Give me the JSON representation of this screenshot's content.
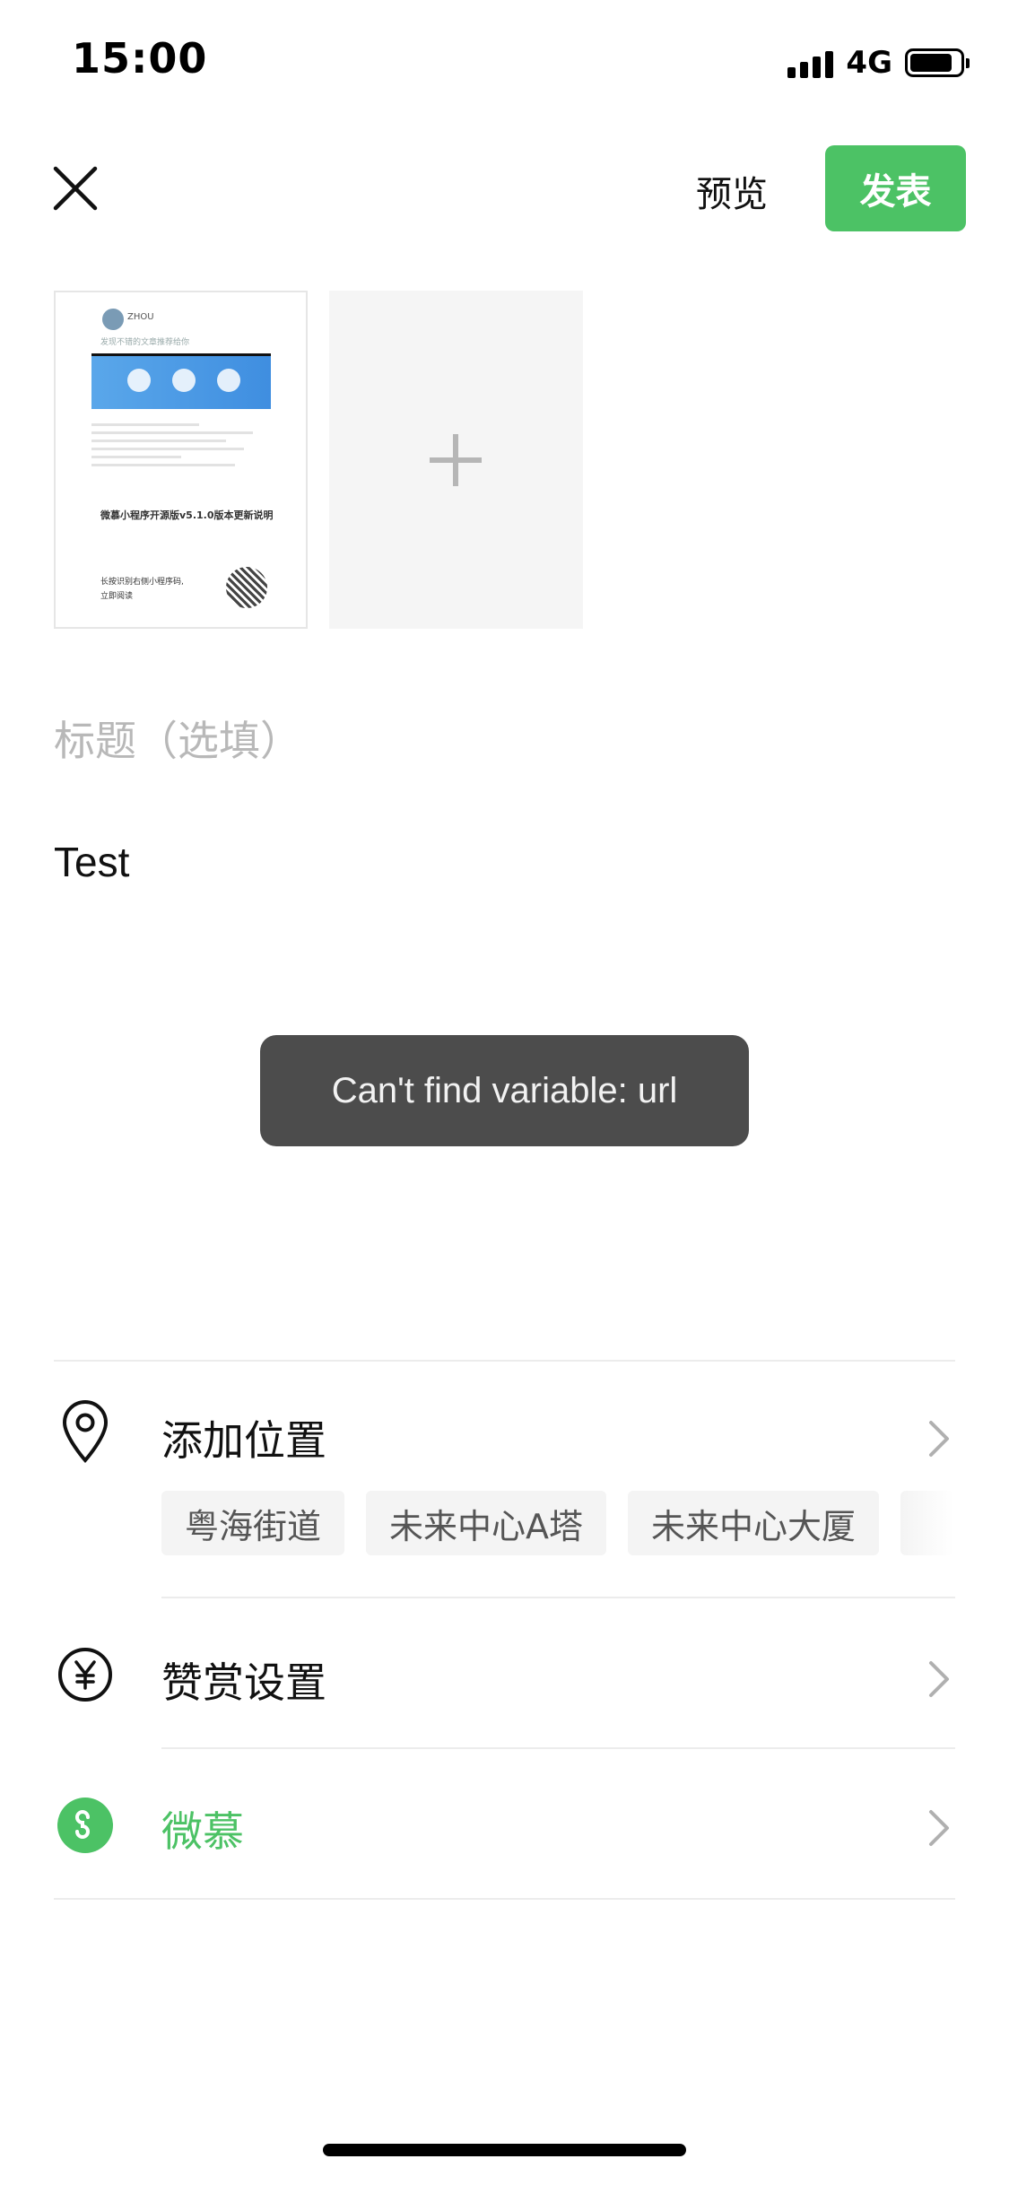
{
  "status_bar": {
    "time": "15:00",
    "network": "4G",
    "signal_icon": "signal-bars-icon",
    "battery_icon": "battery-icon"
  },
  "header": {
    "close_icon": "close-icon",
    "preview_label": "预览",
    "publish_label": "发表",
    "publish_color": "#4cc265"
  },
  "images": {
    "thumbnail": {
      "author": "ZHOU",
      "subtitle": "发现不错的文章推荐给你",
      "caption": "微慕小程序开源版v5.1.0版本更新说明",
      "footer_line1": "长按识别右侧小程序码,",
      "footer_line2": "立即阅读"
    },
    "add_icon": "plus-icon"
  },
  "compose": {
    "title_placeholder": "标题（选填）",
    "body_text": "Test"
  },
  "toast": {
    "message": "Can't find variable: url"
  },
  "settings": {
    "location": {
      "icon": "location-pin-icon",
      "label": "添加位置",
      "suggestions": [
        "粤海街道",
        "未来中心A塔",
        "未来中心大厦"
      ]
    },
    "reward": {
      "icon": "yen-icon",
      "label": "赞赏设置"
    },
    "mini_program": {
      "icon": "mini-program-icon",
      "label": "微慕",
      "color": "#4cc265"
    }
  }
}
